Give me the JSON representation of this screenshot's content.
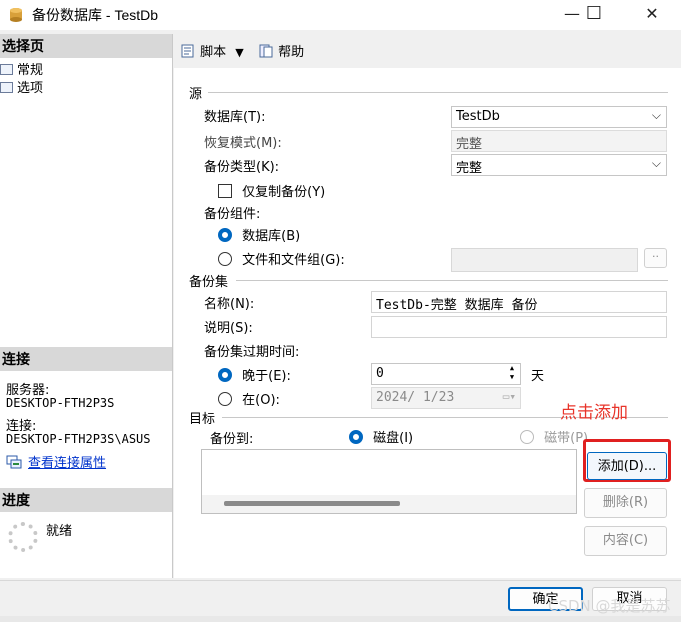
{
  "window": {
    "title": "备份数据库 - TestDb",
    "minimize": "—",
    "maximize": "☐",
    "close": "✕"
  },
  "sidebar": {
    "select_page_header": "选择页",
    "pages": [
      "常规",
      "选项"
    ],
    "connection_header": "连接",
    "server_label": "服务器:",
    "server_value": "DESKTOP-FTH2P3S",
    "connection_label": "连接:",
    "connection_value": "DESKTOP-FTH2P3S\\ASUS",
    "view_connection_props": "查看连接属性",
    "progress_header": "进度",
    "progress_status": "就绪"
  },
  "toolbar": {
    "script_label": "脚本",
    "help_label": "帮助"
  },
  "source": {
    "header": "源",
    "database_label": "数据库(T):",
    "database_value": "TestDb",
    "recovery_label": "恢复模式(M):",
    "recovery_value": "完整",
    "backup_type_label": "备份类型(K):",
    "backup_type_value": "完整",
    "copy_only_label": "仅复制备份(Y)",
    "component_label": "备份组件:",
    "component_db_label": "数据库(B)",
    "component_files_label": "文件和文件组(G):",
    "ellipsis": "··"
  },
  "backup_set": {
    "header": "备份集",
    "name_label": "名称(N):",
    "name_value": "TestDb-完整 数据库 备份",
    "description_label": "说明(S):",
    "description_value": "",
    "expire_label": "备份集过期时间:",
    "after_label": "晚于(E):",
    "after_value": "0",
    "days_label": "天",
    "on_label": "在(O):",
    "on_value": "2024/ 1/23"
  },
  "destination": {
    "header": "目标",
    "backup_to_label": "备份到:",
    "disk_label": "磁盘(I)",
    "tape_label": "磁带(P)",
    "add_button": "添加(D)...",
    "remove_button": "删除(R)",
    "contents_button": "内容(C)",
    "annotation": "点击添加"
  },
  "footer": {
    "ok_button": "确定",
    "cancel_button": "取消",
    "watermark": "CSDN @我是苏苏"
  },
  "colors": {
    "accent": "#0067c0",
    "annotation": "#e8342a",
    "link": "#0033cc"
  }
}
